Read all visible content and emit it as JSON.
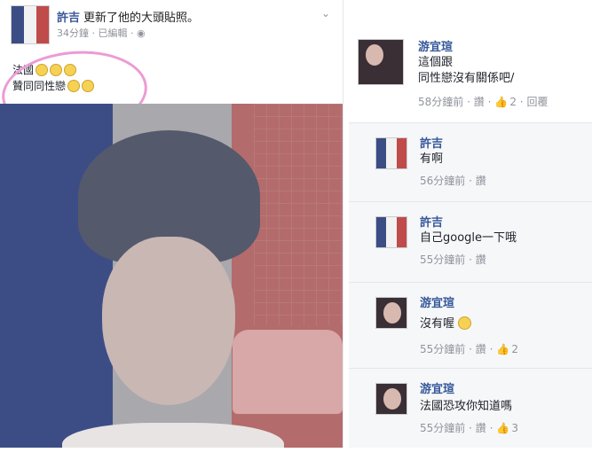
{
  "colors": {
    "flag_blue": "#3c4d86",
    "flag_white": "#f2f2f2",
    "flag_red": "#c04b4b",
    "link": "#365899",
    "highlight": "#ec9bd6"
  },
  "post": {
    "author": "許吉",
    "action": "更新了他的大頭貼照。",
    "time": "34分鐘",
    "edited": "已編輯",
    "privacy_icon": "globe-icon",
    "menu_icon": "chevron-down-icon",
    "text_line1": "法國",
    "text_line2": "贊同同性戀"
  },
  "comments": [
    {
      "name": "游宜瑄",
      "text": "這個跟\n同性戀沒有關係吧/",
      "time": "58分鐘前",
      "like": "讚",
      "likes": "2",
      "reply": "回覆",
      "avatar": "girl-avatar"
    },
    {
      "name": "許吉",
      "text": "有啊",
      "time": "56分鐘前",
      "like": "讚",
      "avatar": "flag-avatar"
    },
    {
      "name": "許吉",
      "text": "自己google一下哦",
      "time": "55分鐘前",
      "like": "讚",
      "avatar": "flag-avatar"
    },
    {
      "name": "游宜瑄",
      "text": "沒有喔",
      "time": "55分鐘前",
      "like": "讚",
      "likes": "2",
      "avatar": "girl-avatar"
    },
    {
      "name": "游宜瑄",
      "text": "法國恐攻你知道嗎",
      "time": "55分鐘前",
      "like": "讚",
      "likes": "3",
      "avatar": "girl-avatar"
    }
  ]
}
